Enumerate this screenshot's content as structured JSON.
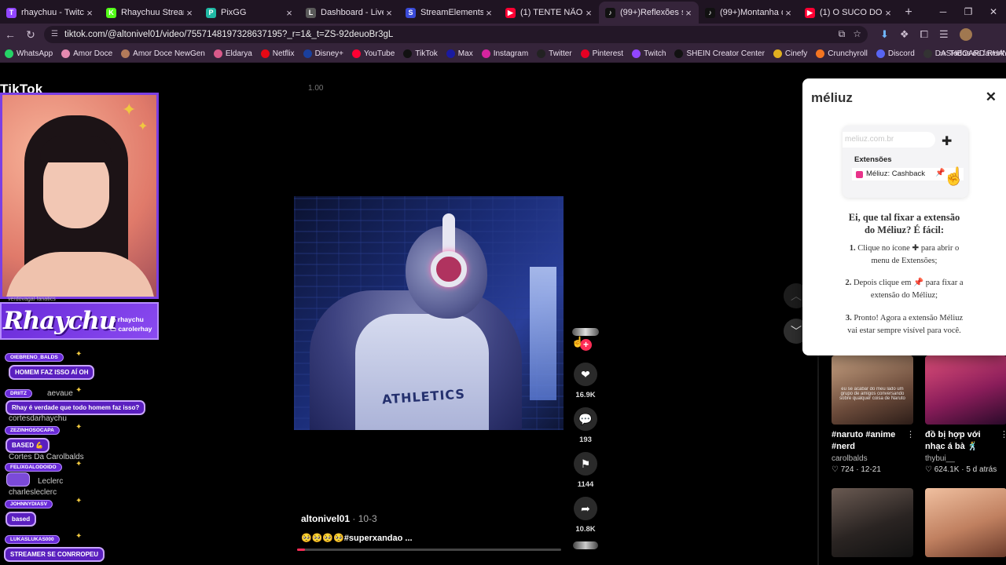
{
  "browser": {
    "tabs": [
      {
        "title": "rhaychuu - Twitch",
        "fav": "T",
        "color": "#9146ff",
        "active": false
      },
      {
        "title": "Rhaychuu Stream - W",
        "fav": "K",
        "color": "#53fc18",
        "active": false
      },
      {
        "title": "PixGG",
        "fav": "P",
        "color": "#1fb8a4",
        "active": false
      },
      {
        "title": "Dashboard - LivePix",
        "fav": "L",
        "color": "#5a5a5a",
        "active": false
      },
      {
        "title": "StreamElements - Ac",
        "fav": "S",
        "color": "#3a4bd8",
        "active": false
      },
      {
        "title": "(1) TENTE NÃO CANT",
        "fav": "▶",
        "color": "#ff0033",
        "active": false
      },
      {
        "title": "(99+)Reflexões sobre",
        "fav": "♪",
        "color": "#111111",
        "active": true
      },
      {
        "title": "(99+)Montanha de P",
        "fav": "♪",
        "color": "#111111",
        "active": false
      },
      {
        "title": "(1) O SUCO DO STITC",
        "fav": "▶",
        "color": "#ff0033",
        "active": false
      }
    ],
    "url": "tiktok.com/@altonivel01/video/7557148197328637195?_r=1&_t=ZS-92deuoBr3gL",
    "bookmarks": [
      {
        "label": "WhatsApp",
        "color": "#25d366"
      },
      {
        "label": "Amor Doce",
        "color": "#e58ab0"
      },
      {
        "label": "Amor Doce NewGen",
        "color": "#b37a5a"
      },
      {
        "label": "Eldarya",
        "color": "#d85a8a"
      },
      {
        "label": "Netflix",
        "color": "#e50914"
      },
      {
        "label": "Disney+",
        "color": "#1a3f9c"
      },
      {
        "label": "YouTube",
        "color": "#ff0033"
      },
      {
        "label": "TikTok",
        "color": "#111111"
      },
      {
        "label": "Max",
        "color": "#1a1aa0"
      },
      {
        "label": "Instagram",
        "color": "#d6249f"
      },
      {
        "label": "Twitter",
        "color": "#222222"
      },
      {
        "label": "Pinterest",
        "color": "#e60023"
      },
      {
        "label": "Twitch",
        "color": "#9146ff"
      },
      {
        "label": "SHEIN Creator Center",
        "color": "#111111"
      },
      {
        "label": "Cinefy",
        "color": "#e0b020"
      },
      {
        "label": "Crunchyroll",
        "color": "#f47521"
      },
      {
        "label": "Discord",
        "color": "#5865f2"
      },
      {
        "label": "DASHBOARD RHAY...",
        "color": "#333333"
      }
    ],
    "bookmarks_more": "»",
    "bookmarks_folder": "Todos os favorit"
  },
  "tiktok": {
    "logo": "TikTok",
    "speed": "1.00",
    "video": {
      "author": "altonivel01",
      "date": " · 10-3",
      "caption": "🥺🥺🥺🥺#superxandao ...",
      "tank_print": "ATHLETICS",
      "progress": 0.03
    },
    "actions": {
      "likes": "16.9K",
      "comments": "193",
      "saves": "1144",
      "shares": "10.8K"
    },
    "recommended": [
      {
        "title": "#naruto #anime #nerd",
        "author": "carolbalds",
        "meta": "♡ 724 · 12-21",
        "overlay": "eu se acabar do meu lado um grupo de amigos conversando sobre qualquer coisa de Naruto",
        "bg": "linear-gradient(160deg,#c9a383,#6a4a3a 60%,#2c1d18)"
      },
      {
        "title": "đồ bị hợp với nhạc á bà 🕺",
        "author": "thybui__",
        "meta": "♡ 624.1K · 5 d atrás",
        "overlay": "",
        "bg": "linear-gradient(160deg,#e0507a,#8a1d5a 55%,#2a0a2a)"
      },
      {
        "title": "",
        "author": "",
        "meta": "",
        "overlay": "",
        "bg": "linear-gradient(160deg,#6a5a52,#2a2422 55%,#111)"
      },
      {
        "title": "",
        "author": "",
        "meta": "",
        "overlay": "",
        "bg": "linear-gradient(160deg,#f0c0a0,#c08060 55%,#6a3a2a)"
      }
    ]
  },
  "meliuz_popup": {
    "brand": "méliuz",
    "close": "✕",
    "illustration": {
      "url": "meliuz.com.br",
      "section": "Extensões",
      "item": "Méliuz: Cashback"
    },
    "heading_line1": "Ei, que tal fixar a extensão",
    "heading_line2": "do Méliuz? É fácil:",
    "step1_num": "1.",
    "step1_a": "Clique no ícone",
    "step1_b": "para abrir o",
    "step1_c": "menu de Extensões;",
    "step2_num": "2.",
    "step2_a": "Depois clique em",
    "step2_b": "para fixar a",
    "step2_c": "extensão do Méliuz;",
    "step3_num": "3.",
    "step3_a": "Pronto! Agora a extensão Méliuz",
    "step3_b": "vai estar sempre visível para você."
  },
  "stream_overlay": {
    "name": "Rhaychu",
    "socials": [
      "rhaychu",
      "carolerhay"
    ],
    "top_fragment": "verdovagal·fanatics",
    "chat": [
      {
        "user": "OIEBRENO_BALDS",
        "msg": "HOMEM FAZ ISSO AÍ OH"
      },
      {
        "user": "DRIITZ",
        "msg": "Rhay é verdade que todo homem faz isso?"
      },
      {
        "user": "ZEZINHOSOCAPA",
        "msg": "BASED 💪"
      },
      {
        "user": "FELIXGALODOIDO",
        "msg": ""
      },
      {
        "user": "JOHNNYDIASV",
        "msg": "based"
      },
      {
        "user": "LUKASLUKAS000",
        "msg": "STREAMER SE CONRROPEU"
      }
    ],
    "ghosts": [
      "cortesdarhaychu",
      "Cortes Da Carolbalds",
      "Leclerc",
      "charlesleclerc",
      "aevaue"
    ]
  }
}
